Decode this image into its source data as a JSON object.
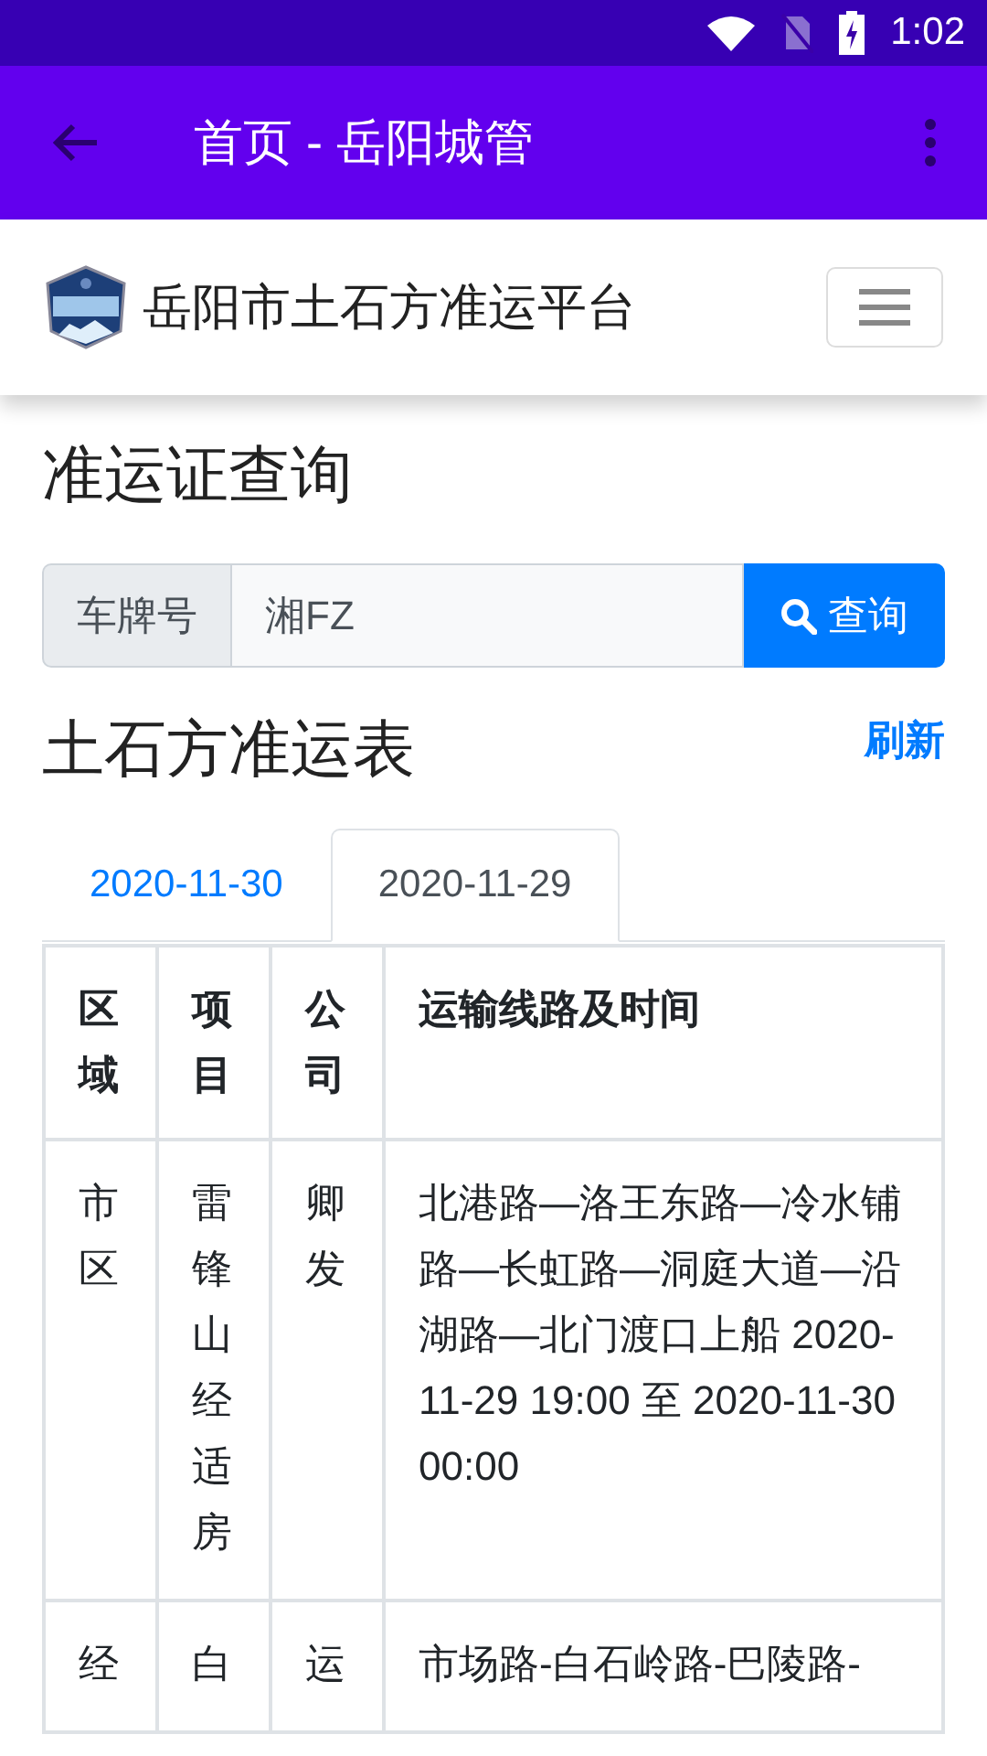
{
  "status_bar": {
    "time": "1:02"
  },
  "app_bar": {
    "title": "首页 - 岳阳城管"
  },
  "navbar": {
    "brand": "岳阳市土石方准运平台"
  },
  "query": {
    "heading": "准运证查询",
    "field_label": "车牌号",
    "value": "湘FZ",
    "button": "查询"
  },
  "table_section": {
    "heading": "土石方准运表",
    "refresh": "刷新"
  },
  "tabs": [
    {
      "label": "2020-11-30",
      "selected": false
    },
    {
      "label": "2020-11-29",
      "selected": true
    }
  ],
  "table": {
    "columns": [
      "区域",
      "项目",
      "公司",
      "运输线路及时间"
    ],
    "rows": [
      {
        "cells": [
          "市区",
          "雷锋山经适房",
          "卿发",
          "北港路—洛王东路—冷水铺路—长虹路—洞庭大道—沿湖路—北门渡口上船 2020-11-29 19:00 至 2020-11-30 00:00"
        ]
      },
      {
        "cells": [
          "经",
          "白",
          "运",
          "市场路-白石岭路-巴陵路-"
        ]
      }
    ]
  }
}
